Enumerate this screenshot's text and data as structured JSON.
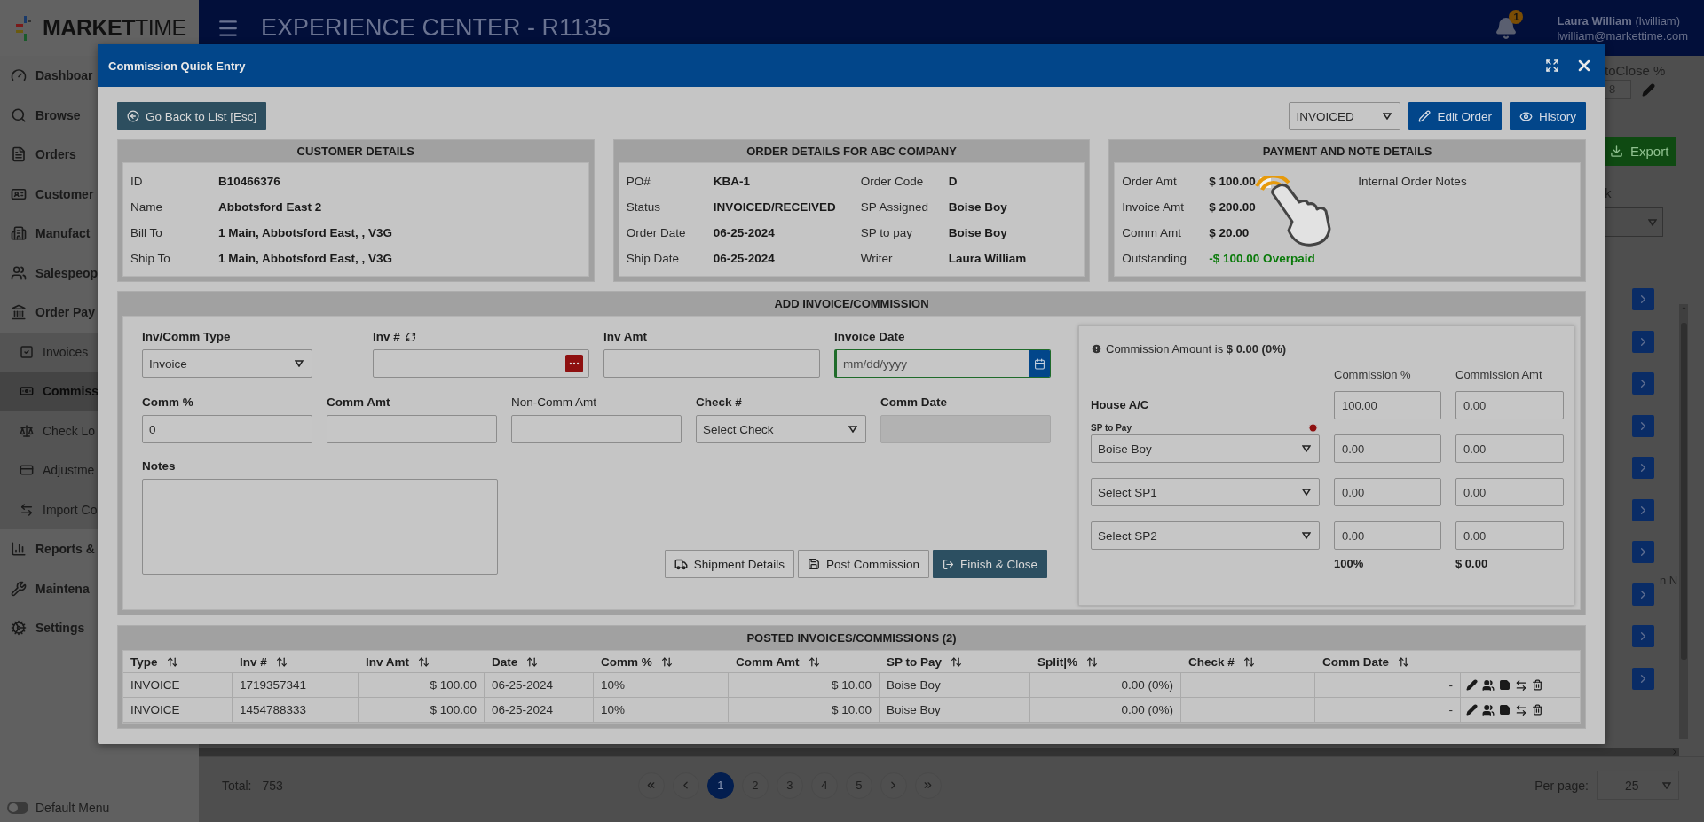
{
  "app": {
    "logo": "**MARKET**TIME",
    "title": "EXPERIENCE CENTER - R1135",
    "notifications": "1",
    "user_name": "**Laura William** (lwilliam)",
    "user_email": "lwilliam@markettime.com"
  },
  "sidebar": {
    "items": [
      {
        "label": "Dashboar",
        "selected": false
      },
      {
        "label": "Browse",
        "selected": false
      },
      {
        "label": "Orders",
        "selected": false
      },
      {
        "label": "Customer",
        "selected": false
      },
      {
        "label": "Manufact",
        "selected": false
      },
      {
        "label": "Salespeop",
        "selected": false
      },
      {
        "label": "Order Pay",
        "selected": false,
        "children": [
          {
            "label": "Invoices",
            "selected": false
          },
          {
            "label": "Commiss",
            "selected": true
          },
          {
            "label": "Check Lo",
            "selected": false
          },
          {
            "label": "Adjustme",
            "selected": false
          },
          {
            "label": "Import Co",
            "selected": false
          }
        ]
      },
      {
        "label": "Reports &",
        "selected": false
      },
      {
        "label": "Maintena",
        "selected": false
      },
      {
        "label": "Settings",
        "selected": false
      }
    ],
    "default_menu": {
      "label": "Default Menu",
      "on": false
    }
  },
  "background": {
    "autoclose_label": "toClose %",
    "autoclose_value": "8",
    "export_button": "Export",
    "filter_label": "k",
    "row_note": "n N"
  },
  "pagination": {
    "total_label": "Total:",
    "total": "753",
    "pages": [
      {
        "label": "1",
        "selected": true
      },
      {
        "label": "2",
        "selected": false
      },
      {
        "label": "3",
        "selected": false
      },
      {
        "label": "4",
        "selected": false
      },
      {
        "label": "5",
        "selected": false
      }
    ],
    "per_page_label": "Per page:",
    "per_page": "25"
  },
  "modal": {
    "title": "Commission Quick Entry",
    "back_button": "Go Back to List [Esc]",
    "status_select": "INVOICED",
    "edit_button": "Edit Order",
    "history_button": "History",
    "customer": {
      "title": "CUSTOMER DETAILS",
      "fields": [
        {
          "label": "ID",
          "value": "B10466376"
        },
        {
          "label": "Name",
          "value": "Abbotsford East 2"
        },
        {
          "label": "Bill To",
          "value": "1 Main, Abbotsford East, , V3G"
        },
        {
          "label": "Ship To",
          "value": "1 Main, Abbotsford East, , V3G"
        }
      ]
    },
    "order": {
      "title": "ORDER DETAILS FOR ABC COMPANY",
      "fields": [
        {
          "label": "PO#",
          "value": "KBA-1"
        },
        {
          "label": "Order Code",
          "value": "D"
        },
        {
          "label": "Status",
          "value": "INVOICED/RECEIVED"
        },
        {
          "label": "SP Assigned",
          "value": "Boise Boy"
        },
        {
          "label": "Order Date",
          "value": "06-25-2024"
        },
        {
          "label": "SP to pay",
          "value": "Boise Boy"
        },
        {
          "label": "Ship Date",
          "value": "06-25-2024"
        },
        {
          "label": "Writer",
          "value": "Laura William"
        }
      ]
    },
    "payment": {
      "title": "PAYMENT AND NOTE DETAILS",
      "notes_label": "Internal Order Notes",
      "fields": [
        {
          "label": "Order Amt",
          "value": "$ 100.00",
          "kind": "plain"
        },
        {
          "label": "Invoice Amt",
          "value": "$ 200.00",
          "kind": "plain"
        },
        {
          "label": "Comm Amt",
          "value": "$ 20.00",
          "kind": "plain"
        },
        {
          "label": "Outstanding",
          "value": "-$ 100.00 Overpaid",
          "kind": "highlight"
        }
      ]
    },
    "add": {
      "title": "ADD INVOICE/COMMISSION",
      "row_1": [
        {
          "label": "Inv/Comm Type",
          "kind": "select",
          "value": "Invoice",
          "emphasized": true,
          "disabled": false,
          "focused": false
        },
        {
          "label": "Inv #",
          "kind": "number",
          "emphasized": true,
          "disabled": false,
          "focused": false
        },
        {
          "label": "Inv Amt",
          "kind": "text",
          "emphasized": true,
          "disabled": false,
          "focused": false
        },
        {
          "label": "Invoice Date",
          "kind": "date",
          "placeholder": "mm/dd/yyyy",
          "emphasized": true,
          "disabled": false,
          "focused": true
        }
      ],
      "row_2": [
        {
          "label": "Comm %",
          "kind": "text",
          "value": "0",
          "emphasized": true,
          "disabled": false,
          "focused": false
        },
        {
          "label": "Comm Amt",
          "kind": "text",
          "emphasized": true,
          "disabled": false,
          "focused": false
        },
        {
          "label": "Non-Comm Amt",
          "kind": "text",
          "emphasized": false,
          "disabled": false,
          "focused": false
        },
        {
          "label": "Check #",
          "kind": "select",
          "value": "Select Check",
          "emphasized": true,
          "disabled": false,
          "focused": false
        },
        {
          "label": "Comm Date",
          "kind": "text",
          "emphasized": true,
          "disabled": true,
          "focused": false
        }
      ],
      "notes_label": "Notes",
      "buttons": [
        {
          "label": "Shipment Details",
          "kind": "default"
        },
        {
          "label": "Post Commission",
          "kind": "default"
        },
        {
          "label": "Finish & Close",
          "kind": "primary"
        }
      ],
      "split": {
        "info": "Commission Amount is **$ 0.00 (0%)**",
        "percent_header": "Commission %",
        "amount_header": "Commission Amt",
        "rows": [
          {
            "kind": "label",
            "label": "House A/C",
            "percent": "100.00",
            "amount": "0.00"
          },
          {
            "kind": "select",
            "caption": "SP to Pay",
            "alert": true,
            "value": "Boise Boy",
            "percent": "0.00",
            "amount": "0.00"
          },
          {
            "kind": "select",
            "alert": false,
            "value": "Select SP1",
            "percent": "0.00",
            "amount": "0.00"
          },
          {
            "kind": "select",
            "alert": false,
            "value": "Select SP2",
            "percent": "0.00",
            "amount": "0.00"
          }
        ],
        "total_percent": "100%",
        "total_amount": "$ 0.00"
      }
    },
    "posted": {
      "title": "POSTED INVOICES/COMMISSIONS (2)",
      "columns": [
        "Type",
        "Inv #",
        "Inv Amt",
        "Date",
        "Comm %",
        "Comm Amt",
        "SP to Pay",
        "Split|%",
        "Check #",
        "Comm Date"
      ],
      "rows": [
        [
          "INVOICE",
          "1719357341",
          "$ 100.00",
          "06-25-2024",
          "10%",
          "$ 10.00",
          "Boise Boy",
          "0.00 (0%)",
          "",
          "-"
        ],
        [
          "INVOICE",
          "1454788333",
          "$ 100.00",
          "06-25-2024",
          "10%",
          "$ 10.00",
          "Boise Boy",
          "0.00 (0%)",
          "",
          "-"
        ]
      ]
    }
  }
}
